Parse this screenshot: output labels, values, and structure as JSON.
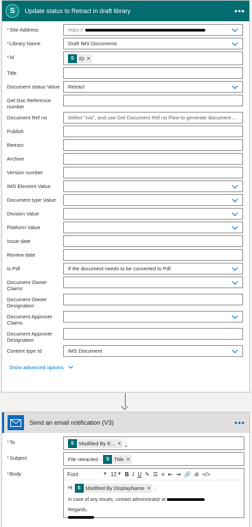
{
  "action1": {
    "title": "Update status to Retract in draft library",
    "fields": {
      "site_address": {
        "label": "Site Address",
        "value": "https://"
      },
      "library_name": {
        "label": "Library Name",
        "value": "Draft IMS Documents"
      },
      "id": {
        "label": "Id",
        "token": "ID"
      },
      "title": {
        "label": "Title",
        "value": ""
      },
      "doc_status": {
        "label": "Document status Value",
        "value": "Retract"
      },
      "get_doc_ref": {
        "label": "Get Doc Reference number",
        "value": ""
      },
      "doc_ref_no": {
        "label": "Document Ref no",
        "placeholder": "Select \"n/a\", and use Get Document Ref no Flow to generate document referen"
      },
      "publish": {
        "label": "Publish",
        "value": ""
      },
      "retract": {
        "label": "Retract",
        "value": ""
      },
      "archive": {
        "label": "Archive",
        "value": ""
      },
      "version_number": {
        "label": "Version number",
        "value": ""
      },
      "ims_element": {
        "label": "IMS Element Value",
        "value": ""
      },
      "doc_type": {
        "label": "Document type Value",
        "value": ""
      },
      "division": {
        "label": "Division Value",
        "value": ""
      },
      "platform": {
        "label": "Platform Value",
        "value": ""
      },
      "issue_date": {
        "label": "Issue date",
        "value": ""
      },
      "review_date": {
        "label": "Review date",
        "value": ""
      },
      "is_pdf": {
        "label": "Is Pdf",
        "value": "If the document needs to be converted to Pdf"
      },
      "owner_claims": {
        "label": "Document Owner Claims",
        "value": ""
      },
      "owner_designation": {
        "label": "Document Owner Designation",
        "value": ""
      },
      "approver_claims": {
        "label": "Document Approver Claims",
        "value": ""
      },
      "approver_designation": {
        "label": "Document Approver Designation",
        "value": ""
      },
      "content_type_id": {
        "label": "Content type Id",
        "value": "IMS Document"
      }
    },
    "advanced_label": "Show advanced options"
  },
  "action2": {
    "title": "Send an email notification (V3)",
    "to": {
      "label": "To",
      "token": "Modified By E...",
      "suffix": ";"
    },
    "subject": {
      "label": "Subject",
      "prefix": "File retracted -",
      "token": "Title"
    },
    "body": {
      "label": "Body",
      "font": "Font",
      "size": "12",
      "hi": "Hi",
      "token": "Modified By DisplayName",
      "after_token": ",",
      "line2": "In case of any issues, contact administrator at",
      "regards": "Regards,"
    }
  },
  "icons": {
    "sharepoint": "S",
    "token_sp": "S"
  },
  "colors": {
    "sharepoint_header": "#036c70",
    "required": "#a4262c",
    "link": "#0078d4",
    "outlook": "#0f6cbd"
  }
}
